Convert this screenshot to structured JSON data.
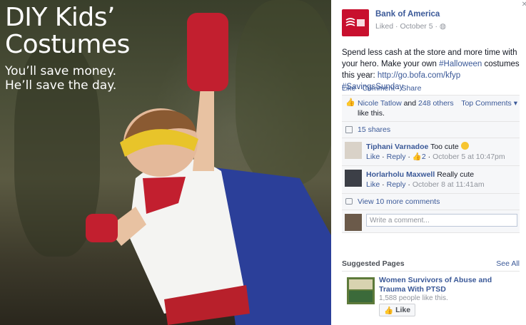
{
  "photo": {
    "title_line1": "DIY Kids’",
    "title_line2": "Costumes",
    "sub_line1": "You’ll save money.",
    "sub_line2": "He’ll save the day."
  },
  "post": {
    "page_name": "Bank of America",
    "status": "Liked",
    "date": "October 5",
    "text_1": "Spend less cash at the store and more time with your hero. Make your own ",
    "hashtag_1": "#Halloween",
    "text_2": " costumes this year: ",
    "link": "http://go.bofa.com/kfyp",
    "hashtag_2": "#SavingsSunday"
  },
  "actions": {
    "like": "Like",
    "comment": "Comment",
    "share": "Share"
  },
  "ufi": {
    "likers_name": "Nicole Tatlow",
    "likers_and": " and ",
    "likers_others": "248 others",
    "likers_tail": " like this.",
    "top_comments": "Top Comments",
    "shares": "15 shares",
    "comments": [
      {
        "author": "Tiphani Varnadoe",
        "text": "Too cute",
        "like": "Like",
        "reply": "Reply",
        "likes": "2",
        "time": "October 5 at 10:47pm"
      },
      {
        "author": "Horlarholu Maxwell",
        "text": "Really cute",
        "like": "Like",
        "reply": "Reply",
        "time": "October 8 at 11:41am"
      }
    ],
    "view_more": "View 10 more comments",
    "write_placeholder": "Write a comment..."
  },
  "suggested": {
    "header": "Suggested Pages",
    "see_all": "See All",
    "name": "Women Survivors of Abuse and Trauma With PTSD",
    "count": "1,588 people like this.",
    "like_button": "Like"
  },
  "colors": {
    "link": "#3b5998",
    "brand": "#c8102e"
  }
}
